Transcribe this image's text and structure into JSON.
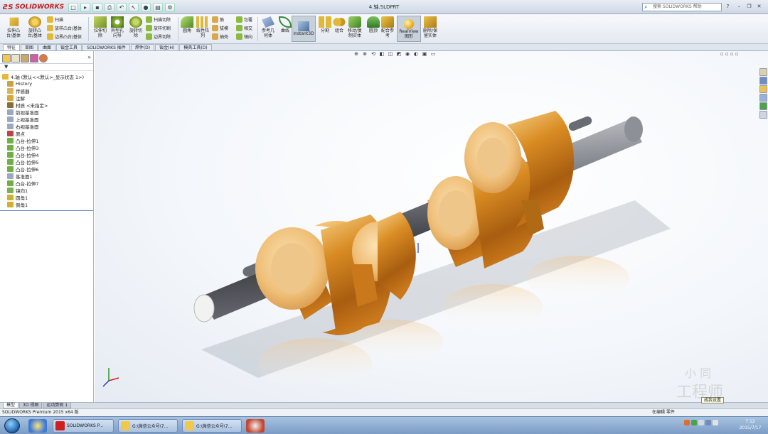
{
  "titlebar": {
    "app_name": "SOLIDWORKS",
    "document_title": "4.轴.SLDPRT",
    "search_placeholder": "搜索 SOLIDWORKS 帮助",
    "help_label": "?",
    "minimize": "–",
    "restore": "❐",
    "close": "✕"
  },
  "command_manager": {
    "extrude_boss": "拉伸凸\n台/基体",
    "revolve_boss": "旋转凸\n台/基体",
    "sweep": "扫描",
    "loft_boss": "放样凸台/基体",
    "boundary_boss": "边界凸台/基体",
    "extrude_cut": "拉伸切\n除",
    "hole_wizard": "异型孔\n向导",
    "revolve_cut": "旋转切\n除",
    "swept_cut": "扫描切除",
    "lofted_cut": "放样切割",
    "boundary_cut": "边界切除",
    "fillet": "圆角",
    "linear_pattern": "线性阵\n列",
    "rib": "筋",
    "draft": "拔模",
    "shell": "抽壳",
    "wrap": "包覆",
    "intersect": "相交",
    "mirror": "镜向",
    "ref_geometry": "参考几\n何体",
    "curves": "曲线",
    "instant3d": "Instant3D",
    "split": "分割",
    "combine": "组合",
    "move_copy": "移动/复\n制实体",
    "indent": "圆顶",
    "mate_ref": "配合参\n考",
    "realview": "RealView\n图形",
    "delete_keep": "删除/保\n留实体"
  },
  "tabs": [
    "特征",
    "草图",
    "曲面",
    "钣金工具",
    "SOLIDWORKS 插件",
    "焊件(D)",
    "钣金(H)",
    "模具工具(D)"
  ],
  "feature_tree": {
    "root": "4.轴 (默认<<默认>_显示状态 1>)",
    "items": [
      {
        "label": "History",
        "color": "#c9a24a"
      },
      {
        "label": "传感器",
        "color": "#d9b45a"
      },
      {
        "label": "注解",
        "color": "#d6a83a"
      },
      {
        "label": "材质 <未指定>",
        "color": "#8a6d3b"
      },
      {
        "label": "前视基准面",
        "color": "#9aa9c0"
      },
      {
        "label": "上视基准面",
        "color": "#9aa9c0"
      },
      {
        "label": "右视基准面",
        "color": "#9aa9c0"
      },
      {
        "label": "原点",
        "color": "#b44"
      },
      {
        "label": "凸台-拉伸1",
        "color": "#6fb046"
      },
      {
        "label": "凸台-拉伸3",
        "color": "#6fb046"
      },
      {
        "label": "凸台-拉伸4",
        "color": "#6fb046"
      },
      {
        "label": "凸台-拉伸5",
        "color": "#6fb046"
      },
      {
        "label": "凸台-拉伸6",
        "color": "#6fb046"
      },
      {
        "label": "基准面1",
        "color": "#9aa9c0"
      },
      {
        "label": "凸台-拉伸7",
        "color": "#6fb046"
      },
      {
        "label": "镜向1",
        "color": "#7ab34d"
      },
      {
        "label": "圆角1",
        "color": "#d0b030"
      },
      {
        "label": "倒角1",
        "color": "#d0b030"
      }
    ]
  },
  "model_tabs": [
    "模型",
    "3D 视图",
    "运动算例 1"
  ],
  "status": {
    "left": "SOLIDWORKS Premium 2015 x64 版",
    "mode": "在编辑 零件",
    "tooltip": "成我设置"
  },
  "taskbar": {
    "tasks": [
      "SOLIDWORKS P...",
      "G:\\微信公众号\\7...",
      "G:\\微信公众号\\7..."
    ],
    "clock_time": "7:12",
    "clock_date": "2015/7/17"
  },
  "watermark": {
    "line1": "小 同",
    "line2": "工程师"
  }
}
